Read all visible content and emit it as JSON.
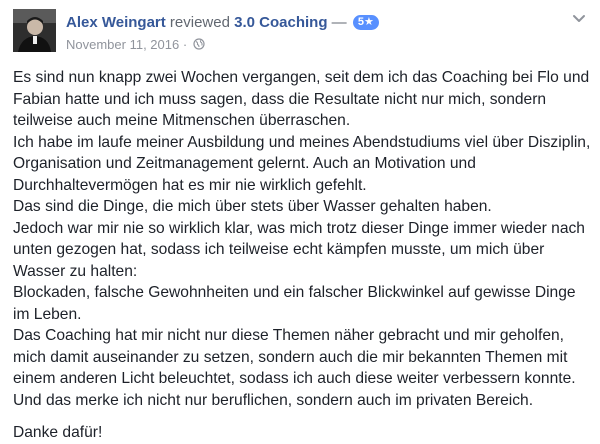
{
  "review": {
    "author": "Alex Weingart",
    "verb": "reviewed",
    "page_name": "3.0 Coaching",
    "dash": "—",
    "rating": "5★",
    "date": "November 11, 2016",
    "separator": "·",
    "privacy_icon": "globe-icon",
    "menu_icon": "chevron-down-icon"
  },
  "body": {
    "lines": [
      "Es sind nun knapp zwei Wochen vergangen, seit dem ich das Coaching bei Flo und Fabian hatte und ich muss sagen, dass die Resultate nicht nur mich, sondern teilweise auch meine Mitmenschen überraschen.",
      "Ich habe im laufe meiner Ausbildung und meines Abendstudiums viel über Disziplin, Organisation und Zeitmanagement gelernt. Auch an Motivation und Durchhaltevermögen hat es mir nie wirklich gefehlt.",
      "Das sind die Dinge, die mich über stets über Wasser gehalten haben.",
      "Jedoch war mir nie so wirklich klar, was mich trotz dieser Dinge immer wieder nach unten gezogen hat, sodass ich teilweise echt kämpfen musste, um mich über Wasser zu halten:",
      "Blockaden, falsche Gewohnheiten und ein falscher Blickwinkel auf gewisse Dinge im Leben.",
      "Das Coaching hat mir nicht nur diese Themen näher gebracht und mir geholfen, mich damit auseinander zu setzen, sondern auch die mir bekannten Themen mit einem anderen Licht beleuchtet, sodass ich auch diese weiter verbessern konnte.",
      "Und das merke ich nicht nur beruflichen, sondern auch im privaten Bereich."
    ],
    "closing": "Danke dafür!"
  }
}
